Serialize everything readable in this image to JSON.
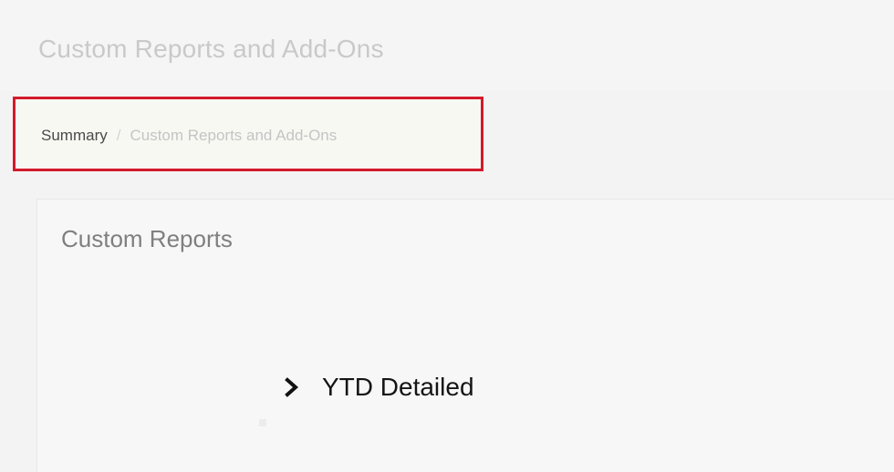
{
  "header": {
    "title": "Custom Reports and Add-Ons"
  },
  "breadcrumb": {
    "items": [
      {
        "label": "Summary"
      },
      {
        "label": "Custom Reports and Add-Ons"
      }
    ],
    "separator": "/"
  },
  "card": {
    "title": "Custom Reports",
    "items": [
      {
        "label": "YTD Detailed",
        "icon": "chevron-right-icon"
      }
    ]
  },
  "colors": {
    "highlight_border": "#d31a2a"
  }
}
